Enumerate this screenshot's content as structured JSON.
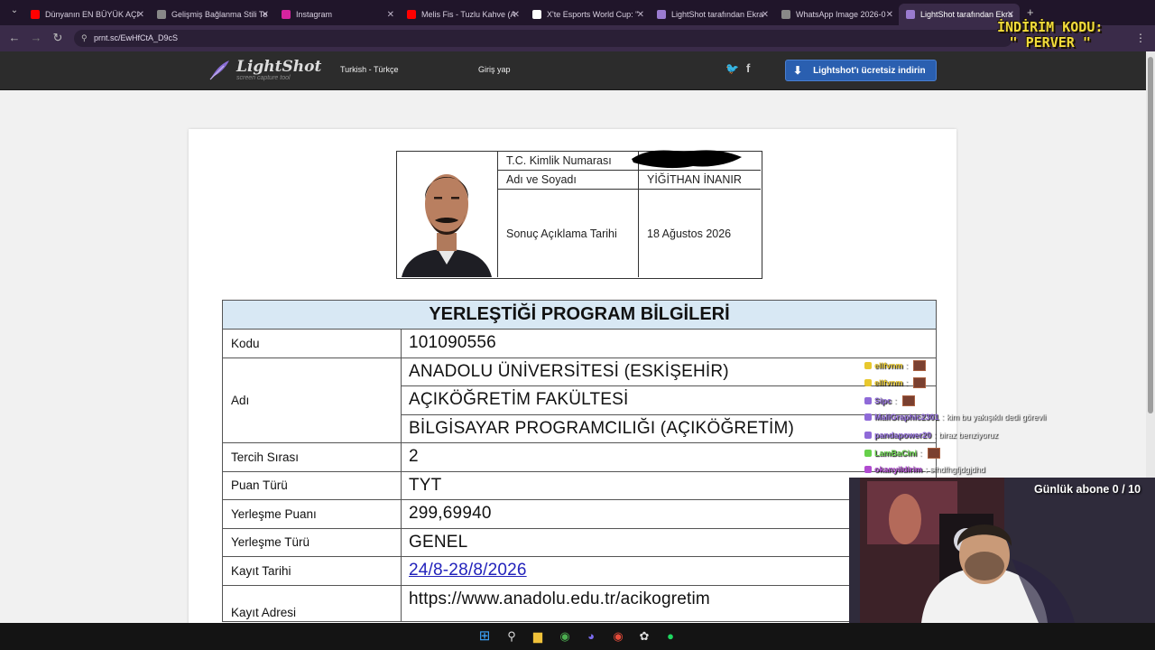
{
  "browser": {
    "tabs": [
      {
        "title": "Dünyanın EN BÜYÜK AÇI",
        "favicon": "youtube-icon",
        "color": "#ff0000"
      },
      {
        "title": "Gelişmiş Bağlanma Stili Te",
        "favicon": "globe-icon",
        "color": "#888888"
      },
      {
        "title": "Instagram",
        "favicon": "instagram-icon",
        "color": "#d6249f"
      },
      {
        "title": "Melis Fis - Tuzlu Kahve (A",
        "favicon": "youtube-icon",
        "color": "#ff0000"
      },
      {
        "title": "X'te Esports World Cup: \"",
        "favicon": "x-icon",
        "color": "#ffffff"
      },
      {
        "title": "LightShot tarafından Ekra",
        "favicon": "lightshot-icon",
        "color": "#9a7bd0"
      },
      {
        "title": "WhatsApp Image 2026-0",
        "favicon": "globe-icon",
        "color": "#888888"
      },
      {
        "title": "LightShot tarafından Ekra",
        "favicon": "lightshot-icon",
        "color": "#9a7bd0",
        "active": true
      }
    ],
    "url": "prnt.sc/EwHfCtA_D9cS"
  },
  "lightshot": {
    "logo": "LightShot",
    "logo_sub": "screen capture tool",
    "language": "Turkish - Türkçe",
    "login": "Giriş yap",
    "download": "Lightshot'ı ücretsiz indirin"
  },
  "id_card": {
    "rows": [
      {
        "label": "T.C. Kimlik Numarası",
        "value": ""
      },
      {
        "label": "Adı ve Soyadı",
        "value": "YİĞİTHAN İNANIR"
      },
      {
        "label": "Sonuç Açıklama Tarihi",
        "value": "18 Ağustos 2026"
      }
    ]
  },
  "program": {
    "heading": "YERLEŞTİĞİ PROGRAM BİLGİLERİ",
    "code_label": "Kodu",
    "code": "101090556",
    "name_label": "Adı",
    "name_lines": [
      "ANADOLU ÜNİVERSİTESİ (ESKİŞEHİR)",
      "AÇIKÖĞRETİM FAKÜLTESİ",
      "BİLGİSAYAR PROGRAMCILIĞI (AÇIKÖĞRETİM)"
    ],
    "rows": [
      {
        "label": "Tercih Sırası",
        "value": "2"
      },
      {
        "label": "Puan Türü",
        "value": "TYT"
      },
      {
        "label": "Yerleşme Puanı",
        "value": "299,69940"
      },
      {
        "label": "Yerleşme Türü",
        "value": "GENEL"
      }
    ],
    "reg_date_label": "Kayıt Tarihi",
    "reg_date": "24/8-28/8/2026",
    "reg_addr_label": "Kayıt Adresi",
    "reg_addr": "https://www.anadolu.edu.tr/acikogretim"
  },
  "stream": {
    "promo_line1": "İNDİRİM KODU:",
    "promo_line2": "\" PERVER \"",
    "sub_goal": "Günlük abone 0 / 10",
    "chat": [
      {
        "user": "ellfvnm",
        "msg": "",
        "color": "#e8c82e"
      },
      {
        "user": "ellfvnm",
        "msg": "",
        "color": "#e8c82e"
      },
      {
        "user": "Sipc",
        "msg": "",
        "color": "#8f6ad8"
      },
      {
        "user": "MaliGraphic2301",
        "msg": "kim bu yakışıklı dedi görevli",
        "color": "#8f6ad8"
      },
      {
        "user": "pandapower20",
        "msg": "biraz benziyoruz",
        "color": "#8f6ad8"
      },
      {
        "user": "LamBaCini",
        "msg": "",
        "color": "#66d04a"
      },
      {
        "user": "okanyildirim",
        "msg": "sfhdfhgfjdgjdhd",
        "color": "#b04ad0"
      }
    ]
  }
}
